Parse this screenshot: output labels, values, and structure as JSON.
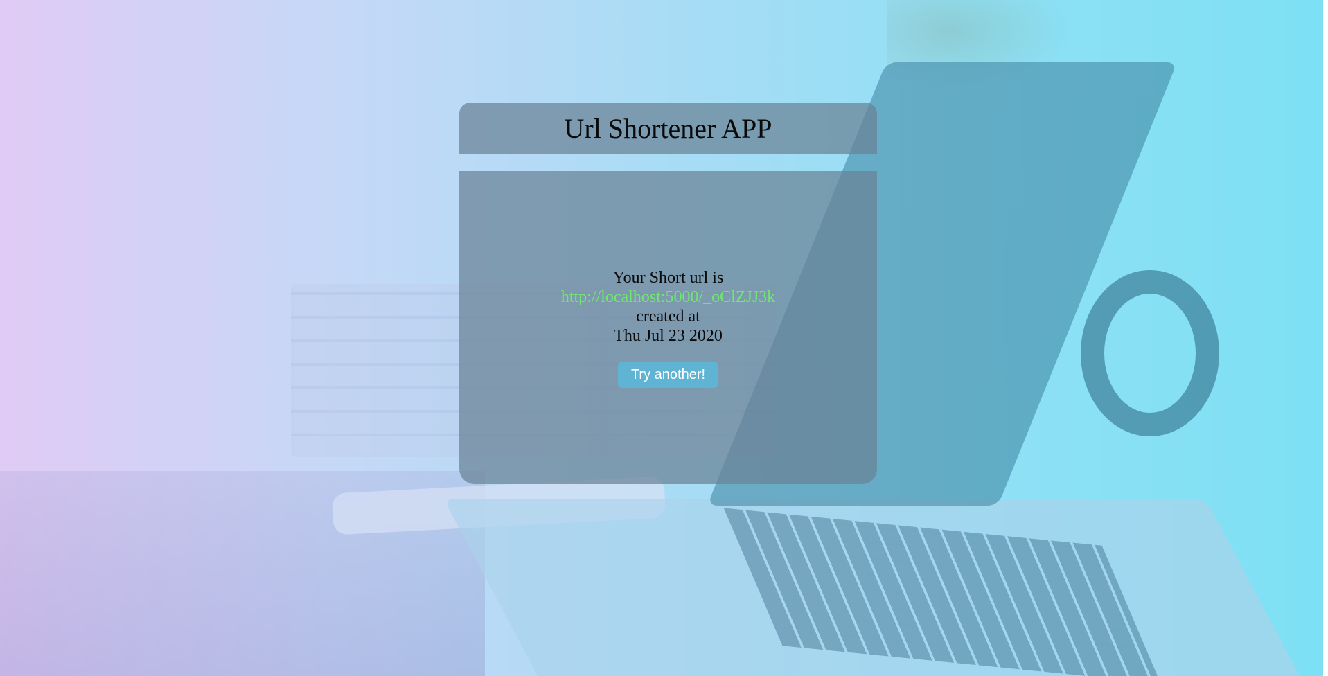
{
  "header": {
    "title": "Url Shortener APP"
  },
  "result": {
    "intro": "Your Short url is",
    "short_url": "http://localhost:5000/_oClZJJ3k",
    "created_label": "created at",
    "created_date": "Thu Jul 23 2020"
  },
  "actions": {
    "try_another_label": "Try another!"
  },
  "colors": {
    "link": "#6fe86f",
    "button": "#5fb4d3",
    "panel": "rgba(105,130,150,0.72)"
  }
}
